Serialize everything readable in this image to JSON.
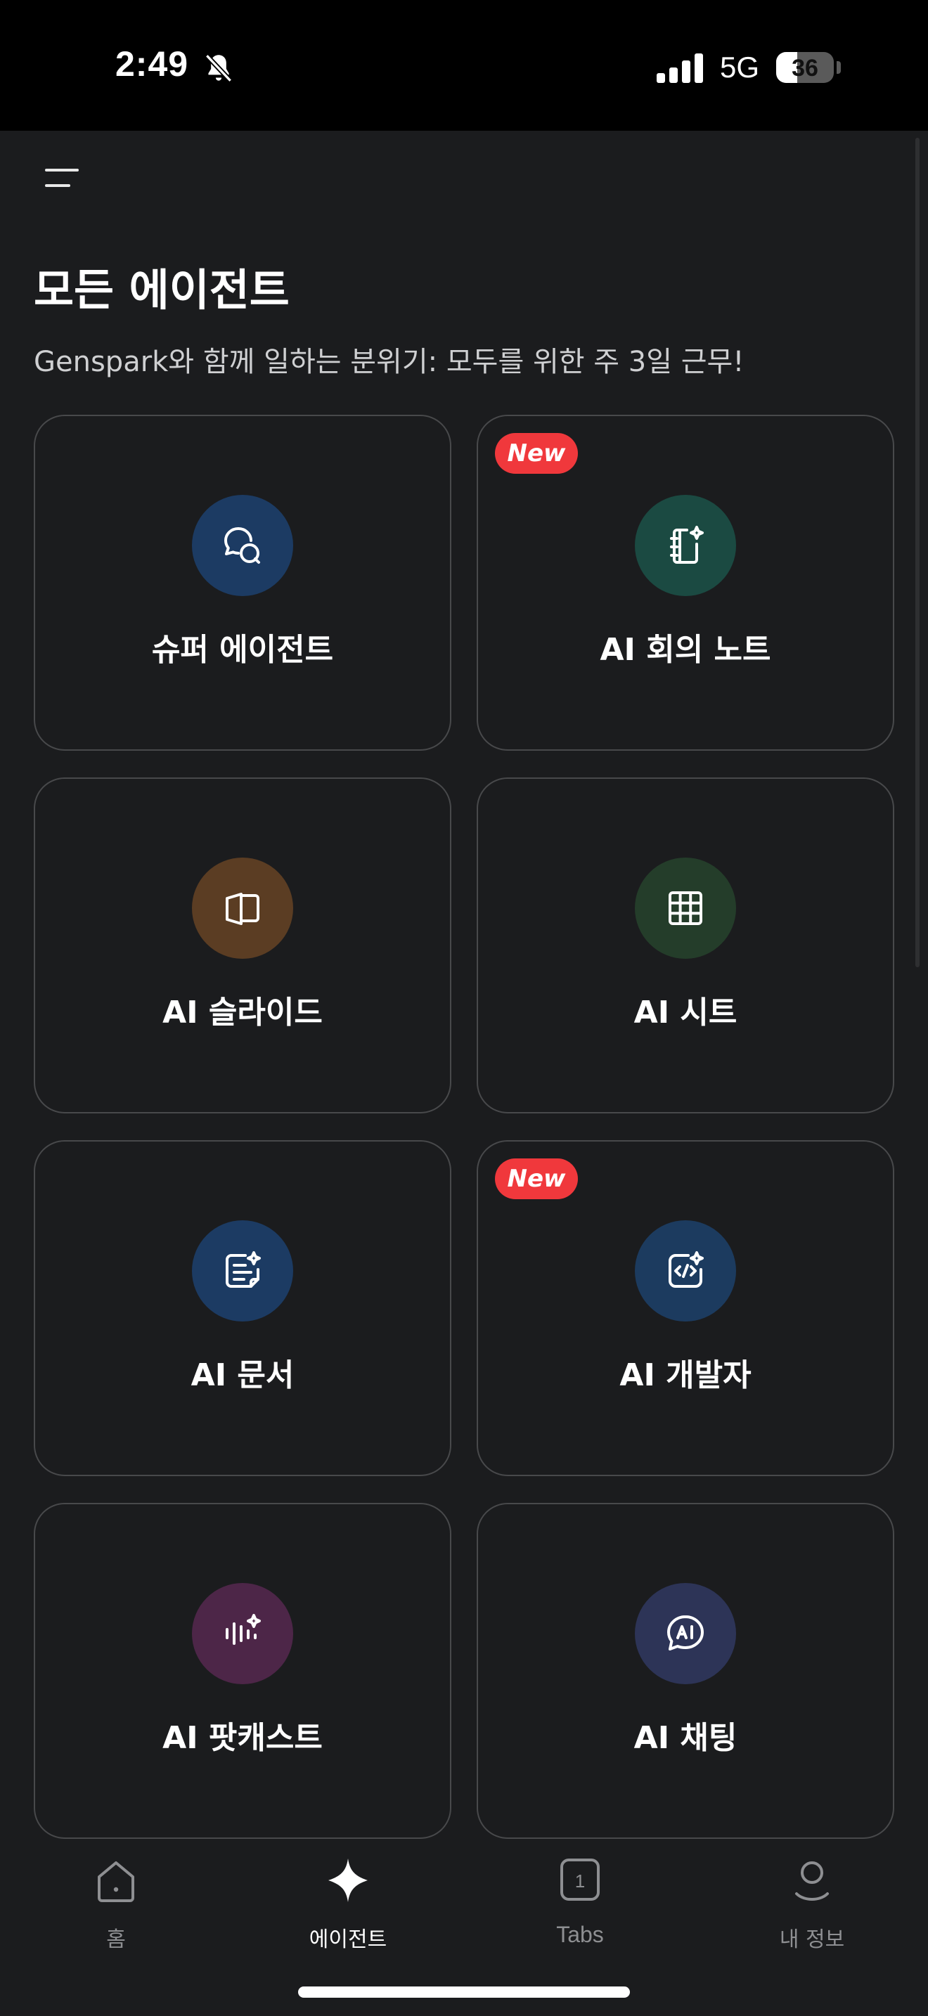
{
  "status_bar": {
    "time": "2:49",
    "network": "5G",
    "battery": "36",
    "battery_level": 0.36
  },
  "page": {
    "title": "모든 에이전트",
    "subtitle": "Genspark와 함께 일하는 분위기: 모두를 위한 주 3일 근무!"
  },
  "badge_label": "New",
  "agents": [
    {
      "label": "슈퍼 에이전트",
      "icon": "chat-bubbles-icon",
      "color": "#1c3b63",
      "is_new": false
    },
    {
      "label": "AI 회의 노트",
      "icon": "notebook-sparkle-icon",
      "color": "#1b4a42",
      "is_new": true
    },
    {
      "label": "AI 슬라이드",
      "icon": "slides-icon",
      "color": "#5b3d23",
      "is_new": false
    },
    {
      "label": "AI 시트",
      "icon": "grid-sheet-icon",
      "color": "#243d2a",
      "is_new": false
    },
    {
      "label": "AI 문서",
      "icon": "document-sparkle-icon",
      "color": "#1c3b63",
      "is_new": false
    },
    {
      "label": "AI 개발자",
      "icon": "code-sparkle-icon",
      "color": "#1c3b5f",
      "is_new": true
    },
    {
      "label": "AI 팟캐스트",
      "icon": "audio-wave-icon",
      "color": "#4d2648",
      "is_new": false
    },
    {
      "label": "AI 채팅",
      "icon": "ai-chat-icon",
      "color": "#2d3457",
      "is_new": false
    }
  ],
  "tab_bar": {
    "home": "홈",
    "agents": "에이전트",
    "tabs": "Tabs",
    "tabs_count": "1",
    "profile": "내 정보"
  }
}
